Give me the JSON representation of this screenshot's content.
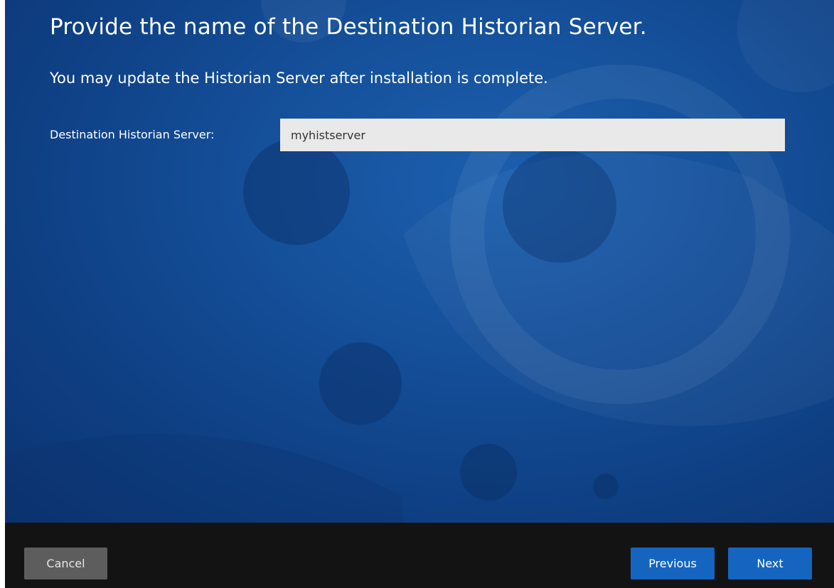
{
  "page": {
    "heading": "Provide the name of the Destination Historian Server.",
    "subheading": "You may update the Historian Server after installation is complete."
  },
  "form": {
    "server_label": "Destination Historian Server:",
    "server_value": "myhistserver"
  },
  "footer": {
    "cancel_label": "Cancel",
    "previous_label": "Previous",
    "next_label": "Next"
  },
  "colors": {
    "background_primary": "#15509a",
    "button_primary": "#1565c0",
    "button_secondary": "#5d5d5d",
    "footer": "#131313"
  }
}
